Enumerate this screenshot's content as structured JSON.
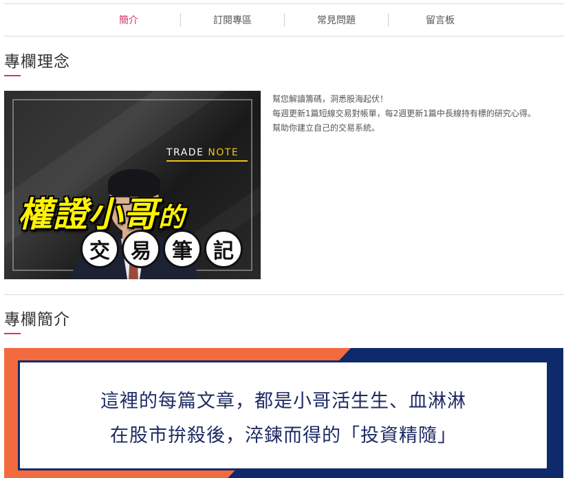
{
  "nav": {
    "tabs": [
      {
        "label": "簡介",
        "active": true
      },
      {
        "label": "訂閱專區",
        "active": false
      },
      {
        "label": "常見問題",
        "active": false
      },
      {
        "label": "留言板",
        "active": false
      }
    ]
  },
  "section1": {
    "title": "專欄理念"
  },
  "feature": {
    "brand_trade": "TRADE",
    "brand_note": "NOTE",
    "headline_main": "權證小哥",
    "headline_suffix": "的",
    "circles": [
      "交",
      "易",
      "筆",
      "記"
    ]
  },
  "intro": {
    "lines": [
      "幫您解讀籌碼，洞悉股海起伏！",
      "每週更新1篇短線交易對帳單，每2週更新1篇中長線持有標的研究心得。",
      "幫助你建立自己的交易系統。"
    ]
  },
  "section2": {
    "title": "專欄簡介"
  },
  "banner": {
    "line1": "這裡的每篇文章，都是小哥活生生、血淋淋",
    "line2": "在股市拚殺後，淬鍊而得的「投資精隨」"
  },
  "colors": {
    "accent": "#d6336c",
    "banner_orange": "#f26b3f",
    "banner_navy": "#0f2a6b",
    "headline_yellow": "#fff200"
  }
}
